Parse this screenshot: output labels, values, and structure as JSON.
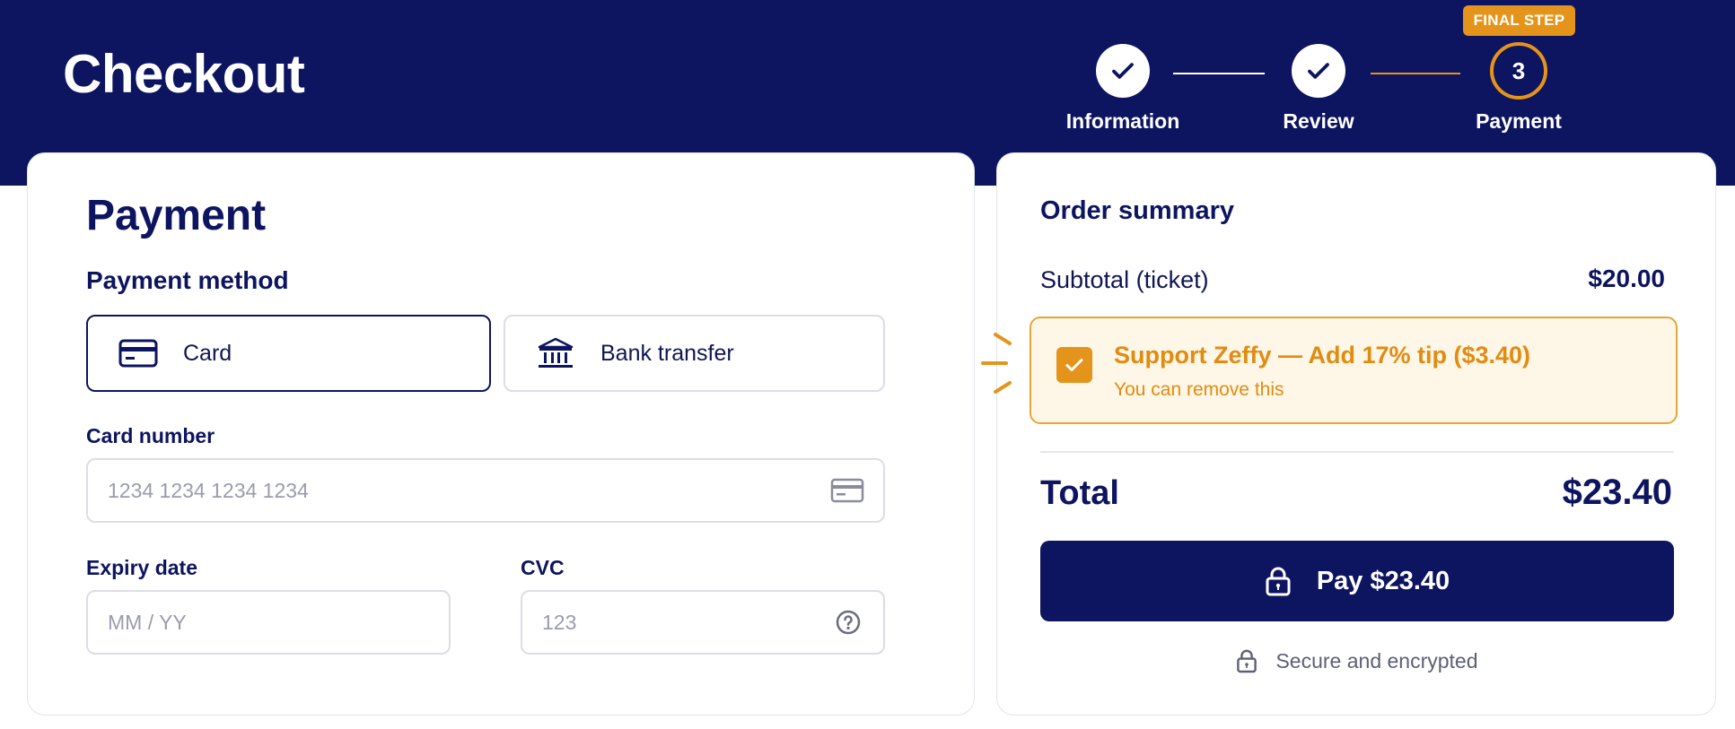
{
  "header": {
    "title": "Checkout",
    "badge": "FINAL STEP",
    "steps": [
      {
        "label": "Information",
        "state": "done",
        "icon": "check-icon"
      },
      {
        "label": "Review",
        "state": "done",
        "icon": "check-icon"
      },
      {
        "label": "Payment",
        "state": "active",
        "number": "3"
      }
    ]
  },
  "payment": {
    "title": "Payment",
    "method_title": "Payment method",
    "methods": [
      {
        "label": "Card",
        "icon": "credit-card-icon",
        "selected": true
      },
      {
        "label": "Bank transfer",
        "icon": "bank-icon",
        "selected": false
      }
    ],
    "card_number": {
      "label": "Card number",
      "placeholder": "1234 1234 1234 1234",
      "value": ""
    },
    "expiry": {
      "label": "Expiry date",
      "placeholder": "MM / YY",
      "value": ""
    },
    "cvc": {
      "label": "CVC",
      "placeholder": "123",
      "value": ""
    }
  },
  "summary": {
    "title": "Order summary",
    "subtotal_label": "Subtotal (ticket)",
    "subtotal_value": "$20.00",
    "tip": {
      "checked": true,
      "title": "Support Zeffy — Add 17% tip ($3.40)",
      "subtitle": "You can remove this"
    },
    "total_label": "Total",
    "total_value": "$23.40",
    "pay_label": "Pay $23.40",
    "secure_text": "Secure and encrypted"
  },
  "colors": {
    "navy": "#0d1460",
    "accent": "#e5941b",
    "tip_bg": "#fef6e6"
  }
}
